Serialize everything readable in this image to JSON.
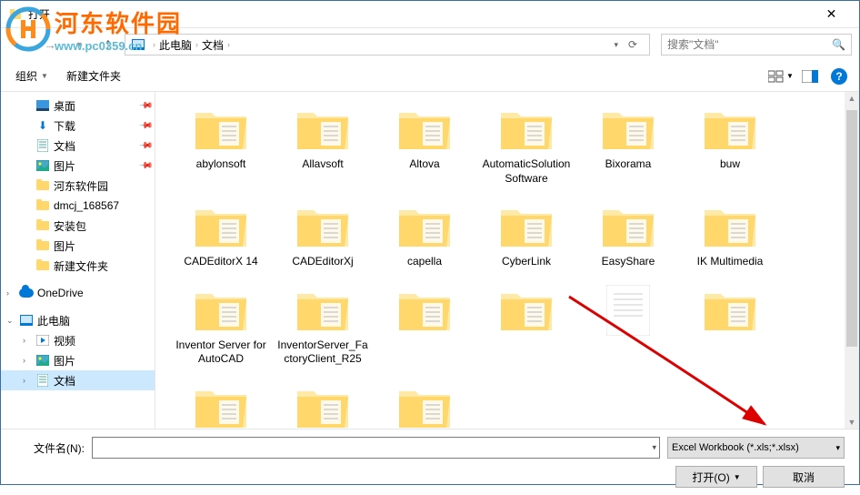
{
  "titlebar": {
    "title": "打开"
  },
  "watermark": {
    "main": "河东软件园",
    "sub": "www.pc0359.cn"
  },
  "breadcrumb": {
    "seg1": "此电脑",
    "seg2": "文档"
  },
  "search": {
    "placeholder": "搜索\"文档\""
  },
  "toolbar": {
    "organize": "组织",
    "newfolder": "新建文件夹"
  },
  "sidebar": {
    "desktop": "桌面",
    "downloads": "下载",
    "documents": "文档",
    "pictures": "图片",
    "hedong": "河东软件园",
    "dmcj": "dmcj_168567",
    "installpkg": "安装包",
    "pictures2": "图片",
    "newfolder": "新建文件夹",
    "onedrive": "OneDrive",
    "thispc": "此电脑",
    "videos": "视频",
    "pictures3": "图片",
    "documents2": "文档"
  },
  "folders": [
    "abylonsoft",
    "Allavsoft",
    "Altova",
    "AutomaticSolution Software",
    "Bixorama",
    "buw",
    "CADEditorX 14",
    "CADEditorXj",
    "capella",
    "CyberLink",
    "EasyShare",
    "IK Multimedia",
    "Inventor Server for AutoCAD",
    "InventorServer_FactoryClient_R25"
  ],
  "footer": {
    "filename_label": "文件名(N):",
    "filetype": "Excel Workbook (*.xls;*.xlsx)",
    "open": "打开(O)",
    "cancel": "取消"
  }
}
